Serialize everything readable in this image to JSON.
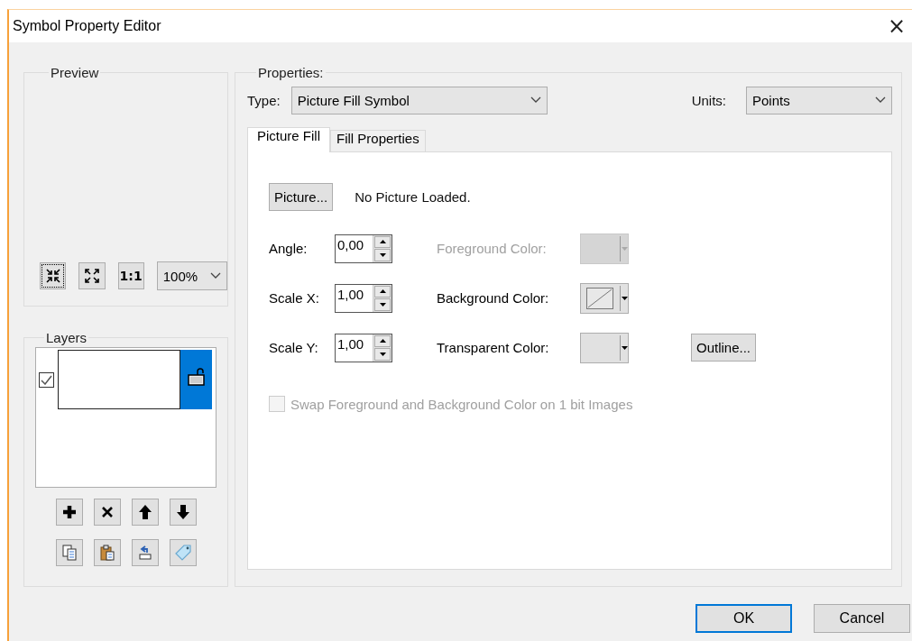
{
  "window": {
    "title": "Symbol Property Editor",
    "close": "×"
  },
  "preview": {
    "label": "Preview",
    "tools": [
      {
        "kind": "shrink",
        "focused": true
      },
      {
        "kind": "expand",
        "focused": false
      },
      {
        "kind": "actual",
        "label": "1:1",
        "focused": false
      }
    ],
    "zoom": "100%"
  },
  "layers": {
    "label": "Layers",
    "items": [
      {
        "checked": true,
        "selected": true
      }
    ],
    "tools": [
      {
        "kind": "add"
      },
      {
        "kind": "delete"
      },
      {
        "kind": "up"
      },
      {
        "kind": "down"
      },
      {
        "kind": "copy"
      },
      {
        "kind": "paste"
      },
      {
        "kind": "reset"
      },
      {
        "kind": "tag"
      }
    ]
  },
  "properties": {
    "label": "Properties:",
    "type_label": "Type:",
    "type_value": "Picture Fill Symbol",
    "units_label": "Units:",
    "units_value": "Points",
    "tabs": [
      {
        "label": "Picture Fill",
        "selected": true
      },
      {
        "label": "Fill Properties",
        "selected": false
      }
    ],
    "picture_button": "Picture...",
    "picture_status": "No Picture Loaded.",
    "spinners": [
      {
        "label": "Angle:",
        "value": "0,00"
      },
      {
        "label": "Scale X:",
        "value": "1,00"
      },
      {
        "label": "Scale Y:",
        "value": "1,00"
      }
    ],
    "colors": [
      {
        "label": "Foreground Color:",
        "disabled": true,
        "kind": "empty"
      },
      {
        "label": "Background Color:",
        "disabled": false,
        "kind": "none"
      },
      {
        "label": "Transparent Color:",
        "disabled": false,
        "kind": "empty"
      }
    ],
    "outline_button": "Outline...",
    "swap": {
      "label": "Swap Foreground and Background Color on 1 bit Images",
      "checked": false,
      "disabled": true
    }
  },
  "buttons": [
    {
      "label": "OK",
      "default": true
    },
    {
      "label": "Cancel",
      "default": false
    }
  ]
}
